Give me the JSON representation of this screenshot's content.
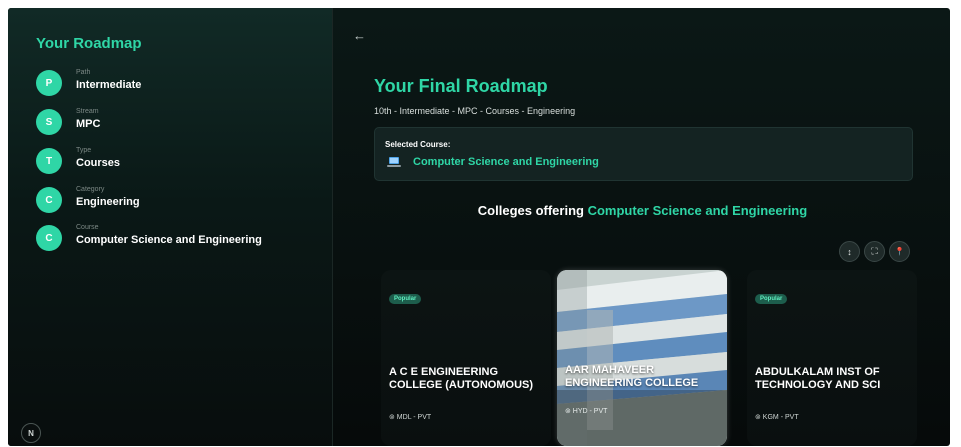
{
  "sidebar": {
    "title": "Your Roadmap",
    "steps": [
      {
        "letter": "P",
        "label": "Path",
        "value": "Intermediate"
      },
      {
        "letter": "S",
        "label": "Stream",
        "value": "MPC"
      },
      {
        "letter": "T",
        "label": "Type",
        "value": "Courses"
      },
      {
        "letter": "C",
        "label": "Category",
        "value": "Engineering"
      },
      {
        "letter": "C",
        "label": "Course",
        "value": "Computer Science and Engineering"
      }
    ],
    "badge": "N"
  },
  "main": {
    "back": "←",
    "title": "Your Final Roadmap",
    "breadcrumb": "10th - Intermediate - MPC - Courses - Engineering",
    "selected_label": "Selected Course:",
    "selected_value": "Computer Science and Engineering",
    "course_icon": "laptop-icon",
    "colleges_prefix": "Colleges offering",
    "colleges_course": "Computer Science and Engineering",
    "toolbar": [
      {
        "icon": "sort-icon",
        "glyph": "↕"
      },
      {
        "icon": "expand-icon",
        "glyph": "⛶"
      },
      {
        "icon": "location-pin-icon",
        "glyph": "📍"
      }
    ],
    "colleges": [
      {
        "badge": "Popular",
        "name": "A C E ENGINEERING COLLEGE (AUTONOMOUS)",
        "location": "⊚ MDL - PVT"
      },
      {
        "badge": "",
        "name": "AAR MAHAVEER ENGINEERING COLLEGE",
        "location": "⊚ HYD - PVT"
      },
      {
        "badge": "Popular",
        "name": "ABDULKALAM INST OF TECHNOLOGY AND SCI",
        "location": "⊚ KGM - PVT"
      }
    ]
  },
  "colors": {
    "accent": "#2fd6a6",
    "background": "#0a0f0f",
    "badge_bg": "#1d5d4c"
  }
}
